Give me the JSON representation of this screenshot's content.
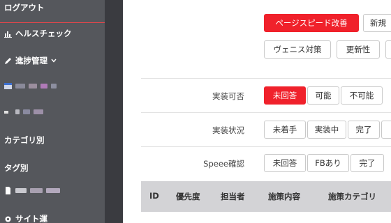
{
  "sidebar": {
    "logout": "ログアウト",
    "health_check": "ヘルスチェック",
    "progress": "進捗管理",
    "category": "カテゴリ別",
    "tag": "タグ別",
    "item_blurred_3": "サイト運",
    "colors": {
      "bg": "#55575c",
      "accent": "#e8454a"
    }
  },
  "actions": {
    "page_speed": "ページスピード改善",
    "new": "新規",
    "venice": "ヴェニス対策",
    "freshness": "更新性"
  },
  "filters": {
    "implement_possible": {
      "label": "実装可否",
      "options": [
        "未回答",
        "可能",
        "不可能"
      ],
      "selected": "未回答"
    },
    "implement_status": {
      "label": "実装状況",
      "options": [
        "未着手",
        "実装中",
        "完了"
      ]
    },
    "speee_check": {
      "label": "Speee確認",
      "options": [
        "未回答",
        "FBあり",
        "完了"
      ]
    }
  },
  "table": {
    "headers": [
      "ID",
      "優先度",
      "担当者",
      "施策内容",
      "施策カテゴリ"
    ]
  }
}
